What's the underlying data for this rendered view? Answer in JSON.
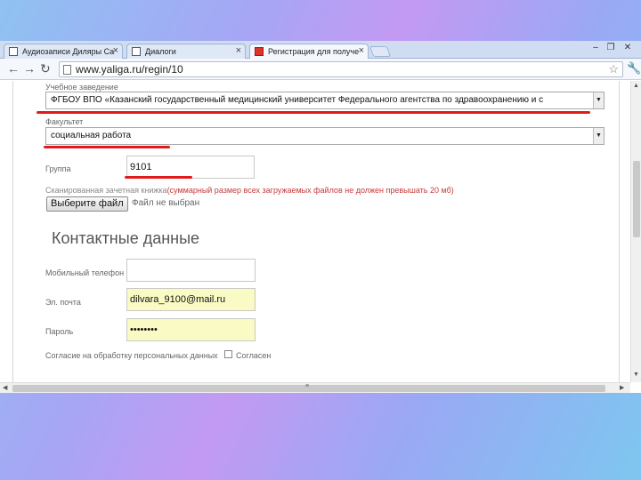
{
  "browser": {
    "tabs": [
      {
        "label": "Аудиозаписи Диляры Са",
        "active": false
      },
      {
        "label": "Диалоги",
        "active": false
      },
      {
        "label": "Регистрация для получе",
        "active": true
      }
    ],
    "url": "www.yaliga.ru/regin/10"
  },
  "form": {
    "institution": {
      "label": "Учебное заведение",
      "value": "ФГБОУ ВПО «Казанский государственный медицинский университет Федерального агентства по здравоохранению и с"
    },
    "faculty": {
      "label": "Факультет",
      "value": "социальная работа"
    },
    "group": {
      "label": "Группа",
      "value": "9101"
    },
    "upload_note": "Сканированная зачетная книжка",
    "upload_note_red": "(суммарный размер всех загружаемых файлов не должен превышать 20 мб)",
    "file_button": "Выберите файл",
    "file_status": "Файл не выбран"
  },
  "contacts": {
    "title": "Контактные данные",
    "phone": {
      "label": "Мобильный телефон",
      "value": ""
    },
    "email": {
      "label": "Эл. почта",
      "value": "dilvara_9100@mail.ru"
    },
    "password": {
      "label": "Пароль",
      "value": "••••••••"
    },
    "consent_label": "Согласие на обработку персональных данных",
    "consent_link": "Согласен"
  },
  "colors": {
    "highlight": "#e01b1b",
    "autofill": "#fafac4"
  }
}
